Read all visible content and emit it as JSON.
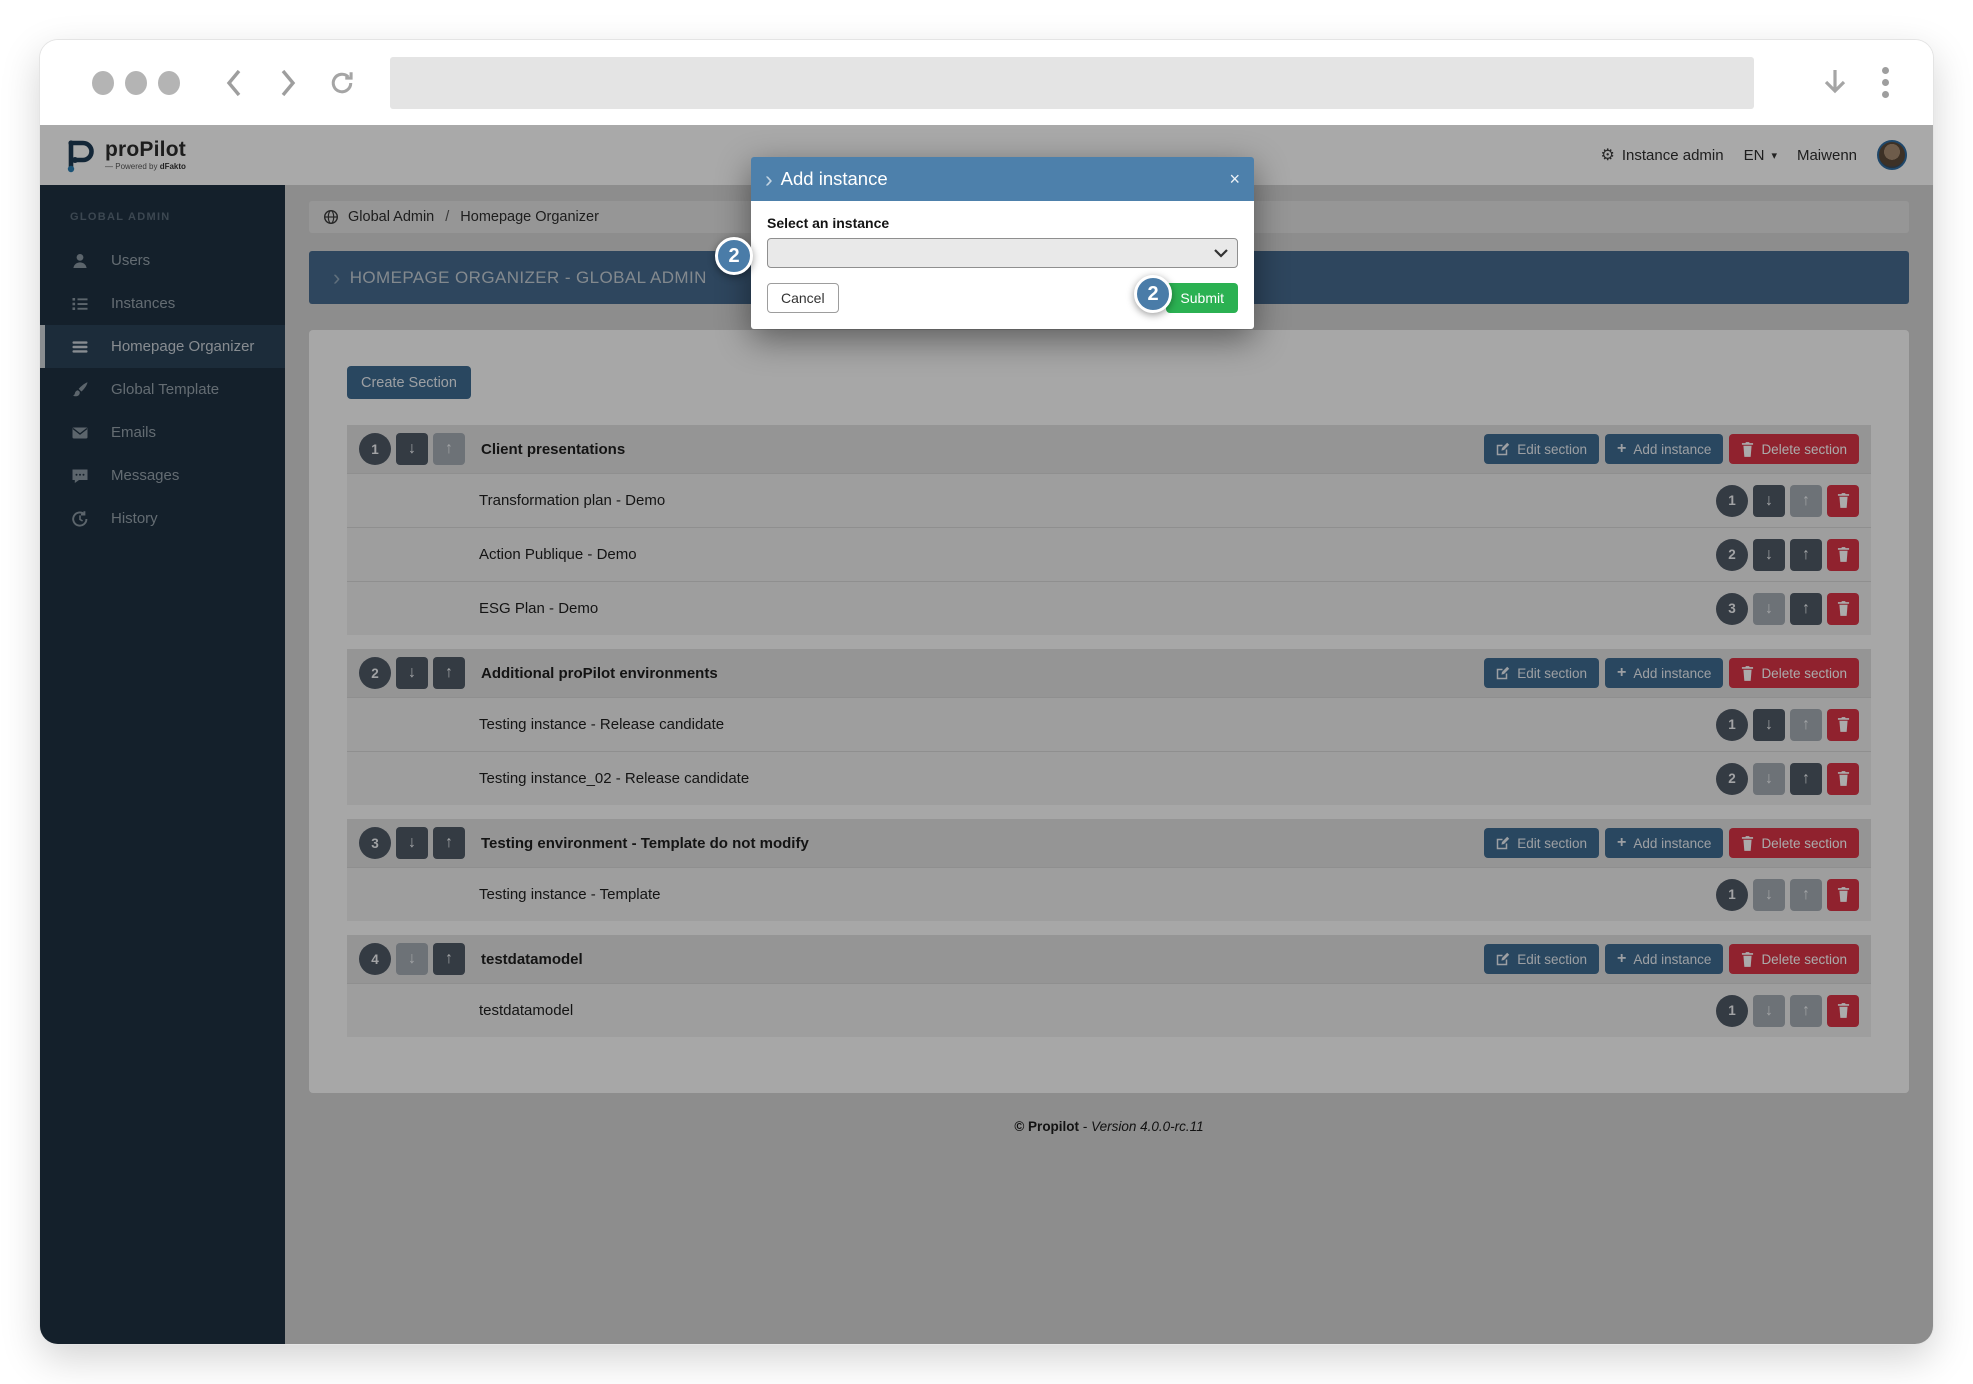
{
  "browser": {
    "address_value": ""
  },
  "header": {
    "brand": "proPilot",
    "brand_sub_prefix": "Powered by ",
    "brand_sub_bold": "dFakto",
    "instance_admin": "Instance admin",
    "lang": "EN",
    "user": "Maiwenn"
  },
  "sidebar": {
    "group": "GLOBAL ADMIN",
    "items": [
      {
        "label": "Users",
        "icon": "user-icon"
      },
      {
        "label": "Instances",
        "icon": "instances-list-icon"
      },
      {
        "label": "Homepage Organizer",
        "icon": "menu-bars-icon",
        "active": true
      },
      {
        "label": "Global Template",
        "icon": "paintbrush-icon"
      },
      {
        "label": "Emails",
        "icon": "envelope-icon"
      },
      {
        "label": "Messages",
        "icon": "chat-bubble-icon"
      },
      {
        "label": "History",
        "icon": "history-clock-icon"
      }
    ]
  },
  "breadcrumb": {
    "item1": "Global Admin",
    "separator": "/",
    "item2": "Homepage Organizer"
  },
  "banner": {
    "title": "HOMEPAGE ORGANIZER - GLOBAL ADMIN"
  },
  "page_actions": {
    "create_section": "Create Section"
  },
  "section_buttons": {
    "edit": "Edit section",
    "add": "Add instance",
    "delete": "Delete section"
  },
  "sections": [
    {
      "number": "1",
      "title": "Client presentations",
      "down_enabled": true,
      "up_enabled": false,
      "rows": [
        {
          "number": "1",
          "name": "Transformation plan - Demo",
          "down_enabled": true,
          "up_enabled": false
        },
        {
          "number": "2",
          "name": "Action Publique - Demo",
          "down_enabled": true,
          "up_enabled": true
        },
        {
          "number": "3",
          "name": "ESG Plan - Demo",
          "down_enabled": false,
          "up_enabled": true
        }
      ]
    },
    {
      "number": "2",
      "title": "Additional proPilot environments",
      "down_enabled": true,
      "up_enabled": true,
      "rows": [
        {
          "number": "1",
          "name": "Testing instance - Release candidate",
          "down_enabled": true,
          "up_enabled": false
        },
        {
          "number": "2",
          "name": "Testing instance_02 - Release candidate",
          "down_enabled": false,
          "up_enabled": true
        }
      ]
    },
    {
      "number": "3",
      "title": "Testing environment - Template do not modify",
      "down_enabled": true,
      "up_enabled": true,
      "rows": [
        {
          "number": "1",
          "name": "Testing instance - Template",
          "down_enabled": false,
          "up_enabled": false
        }
      ]
    },
    {
      "number": "4",
      "title": "testdatamodel",
      "down_enabled": false,
      "up_enabled": true,
      "rows": [
        {
          "number": "1",
          "name": "testdatamodel",
          "down_enabled": false,
          "up_enabled": false
        }
      ]
    }
  ],
  "modal": {
    "title": "Add instance",
    "close": "×",
    "label": "Select an instance",
    "select_value": "",
    "cancel": "Cancel",
    "submit": "Submit",
    "step_badge": "2"
  },
  "footer": {
    "copyright": "© Propilot",
    "separator": " - ",
    "version": "Version 4.0.0-rc.11"
  },
  "glyphs": {
    "down": "↓",
    "up": "↑",
    "chevron": "›",
    "gear": "⚙",
    "caret": "▾",
    "plus": "+"
  },
  "colors": {
    "steel_blue_button": "#3e6b90",
    "modal_header_blue": "#4d80ab",
    "banner_blue": "#45698c",
    "danger_red": "#d73445",
    "submit_green": "#2bb152",
    "sidebar_navy": "#1f3141",
    "badge_blue": "#4a7ca8"
  }
}
